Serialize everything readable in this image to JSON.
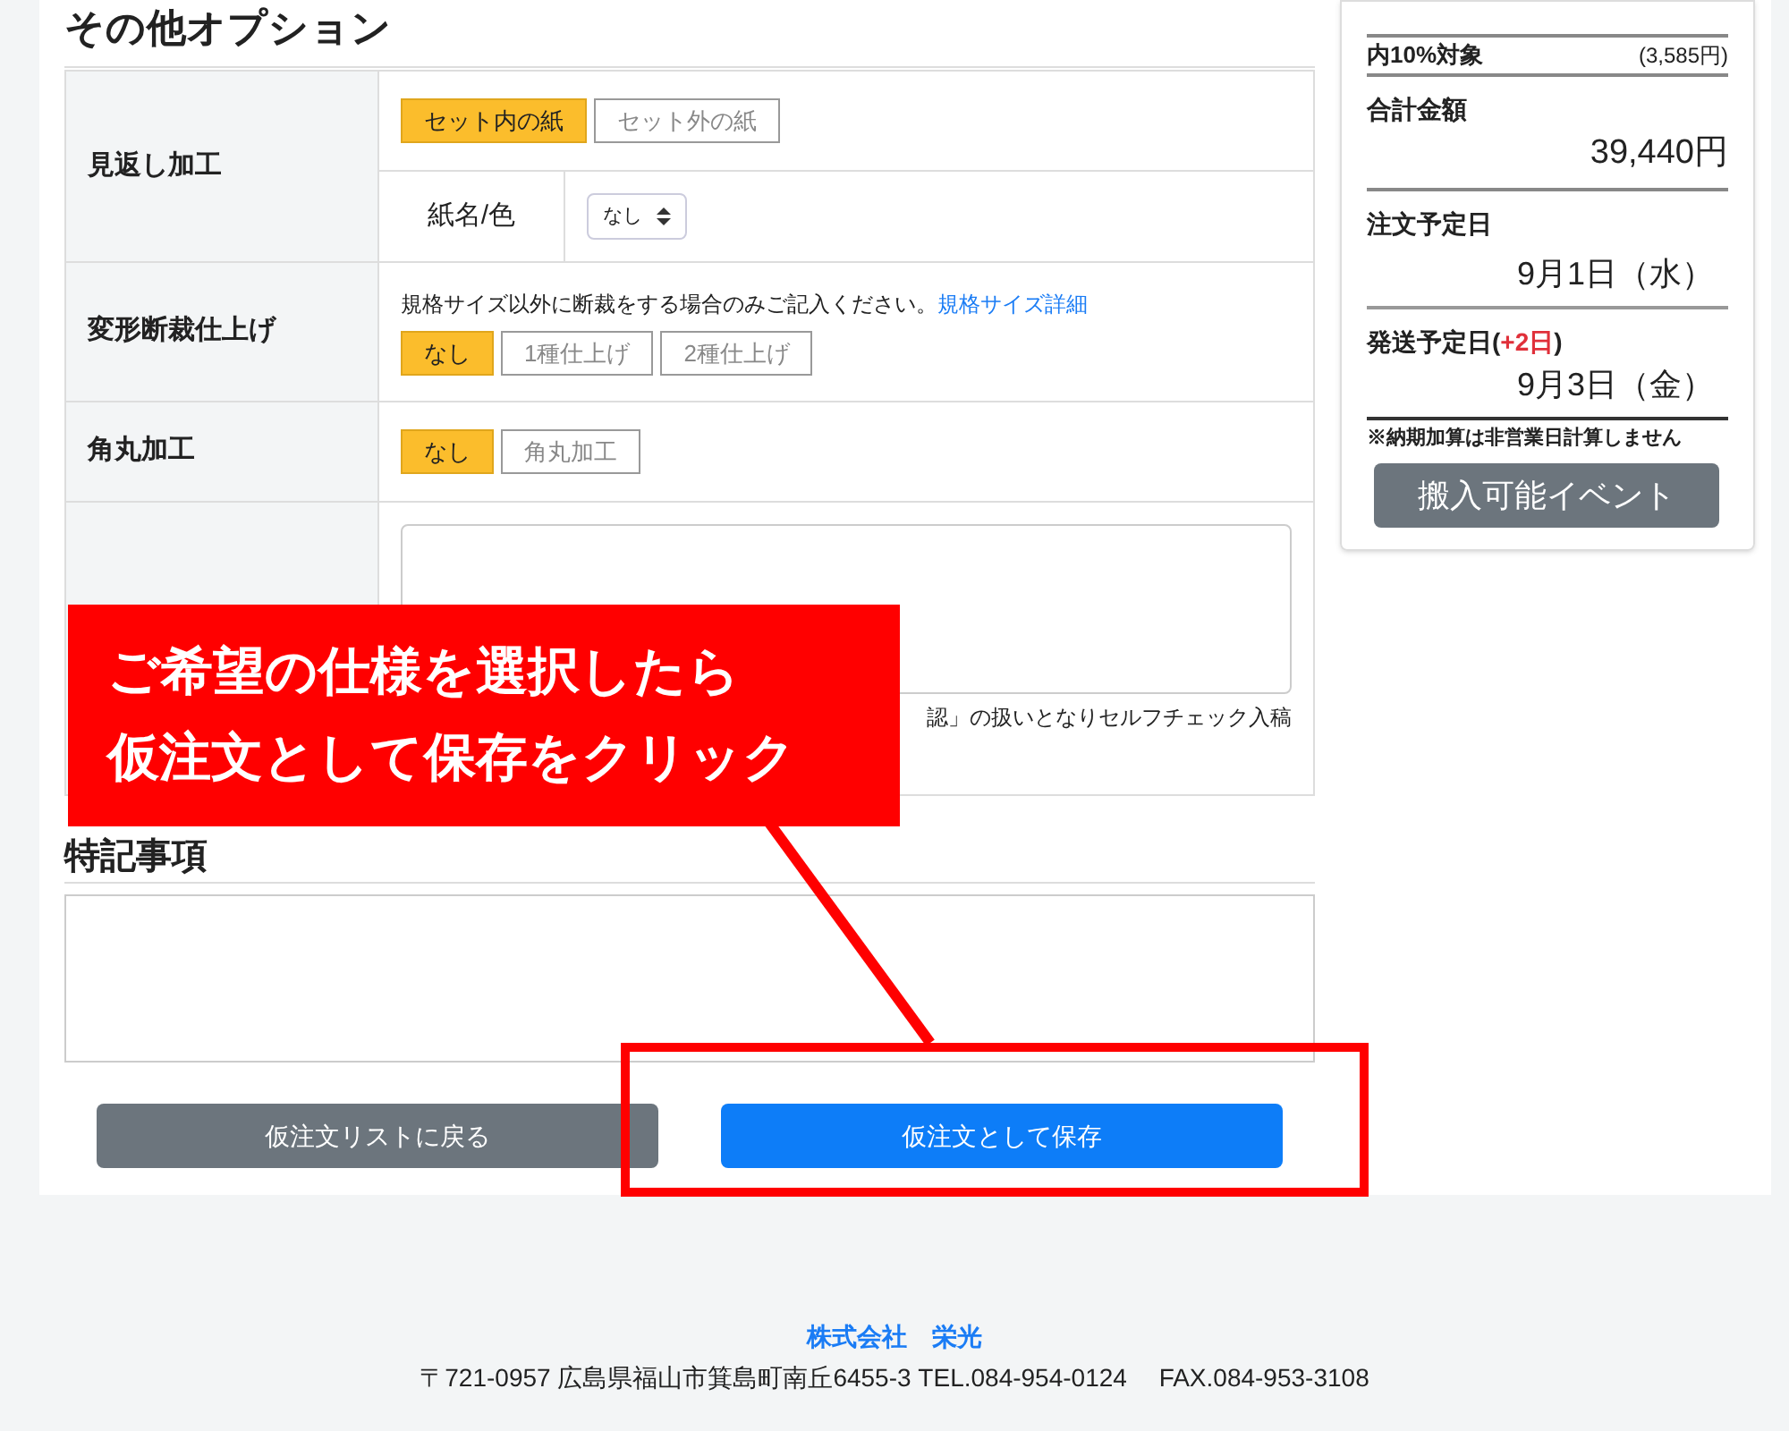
{
  "section_title": "その他オプション",
  "options": [
    {
      "kind": "buttons",
      "label": "見返し加工",
      "choices": [
        {
          "label": "セット内の紙",
          "selected": true
        },
        {
          "label": "セット外の紙",
          "selected": false
        }
      ],
      "sub": {
        "label": "紙名/色",
        "select": "なし"
      }
    },
    {
      "kind": "buttons",
      "label": "変形断裁仕上げ",
      "note": "規格サイズ以外に断裁をする場合のみご記入ください。",
      "link": "規格サイズ詳細",
      "choices": [
        {
          "label": "なし",
          "selected": true
        },
        {
          "label": "1種仕上げ",
          "selected": false
        },
        {
          "label": "2種仕上げ",
          "selected": false
        }
      ]
    },
    {
      "kind": "buttons",
      "label": "角丸加工",
      "choices": [
        {
          "label": "なし",
          "selected": true
        },
        {
          "label": "角丸加工",
          "selected": false
        }
      ]
    },
    {
      "kind": "textarea",
      "note_tail": "認」の扱いとなりセルフチェック入稿"
    }
  ],
  "remarks_title": "特記事項",
  "buttons": {
    "back": "仮注文リストに戻る",
    "save": "仮注文として保存"
  },
  "summary": {
    "tax_label": "内10%対象",
    "tax_value": "(3,585円)",
    "total_label": "合計金額",
    "total_value": "39,440円",
    "order_label": "注文予定日",
    "order_date": "9月1日（水）",
    "ship_label": "発送予定日(",
    "ship_extra": "+2日",
    "ship_close": ")",
    "ship_date": "9月3日（金）",
    "note": "※納期加算は非営業日計算しません",
    "event_button": "搬入可能イベント"
  },
  "callout": {
    "lines": [
      "ご希望の仕様を選択したら",
      "仮注文として保存をクリック"
    ]
  },
  "footer": {
    "company": "株式会社　栄光",
    "address": "〒721-0957 広島県福山市箕島町南丘6455-3 TEL.084-954-0124　 FAX.084-953-3108"
  }
}
